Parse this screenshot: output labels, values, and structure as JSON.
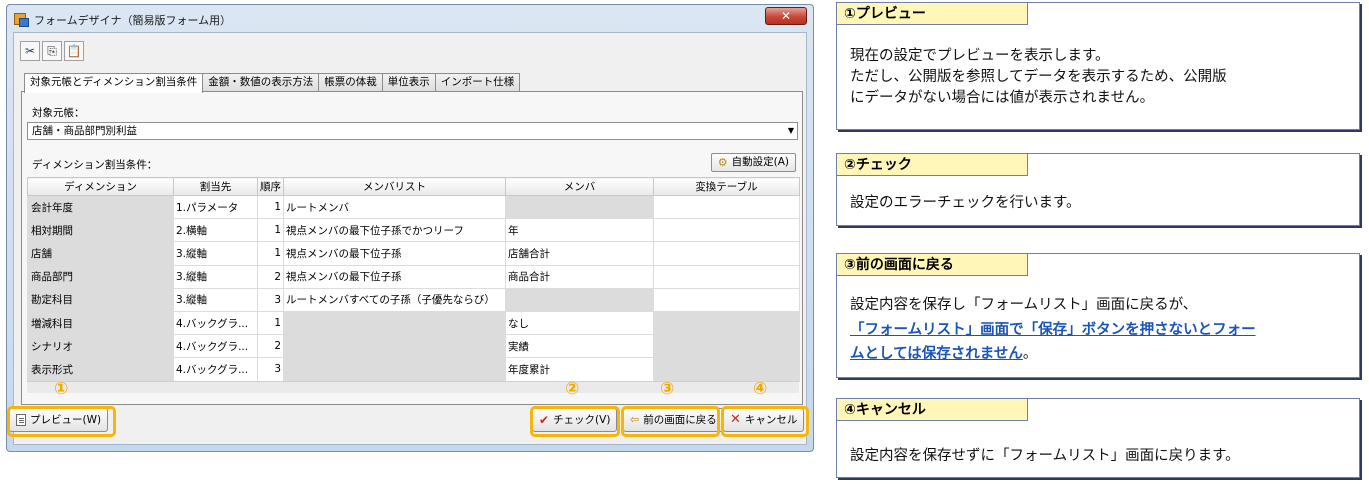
{
  "window": {
    "title": "フォームデザイナ（簡易版フォーム用）",
    "close_glyph": "✕"
  },
  "toolbar": {
    "icons": [
      "scissors-icon",
      "copy-icon",
      "paste-icon"
    ],
    "glyphs": [
      "✂",
      "⎘",
      "📋"
    ]
  },
  "tabs": [
    {
      "label": "対象元帳とディメンション割当条件",
      "active": true
    },
    {
      "label": "金額・数値の表示方法",
      "active": false
    },
    {
      "label": "帳票の体裁",
      "active": false
    },
    {
      "label": "単位表示",
      "active": false
    },
    {
      "label": "インポート仕様",
      "active": false
    }
  ],
  "target_ledger": {
    "label": "対象元帳：",
    "value": "店舗・商品部門別利益"
  },
  "dimension_section": {
    "label": "ディメンション割当条件：",
    "auto_button": "自動設定(A)"
  },
  "grid": {
    "columns": [
      "ディメンション",
      "割当先",
      "順序",
      "メンバリスト",
      "メンバ",
      "変換テーブル"
    ],
    "rows": [
      {
        "dimension": "会計年度",
        "assign": "1.パラメータ",
        "order": "1",
        "member_list": "ルートメンバ",
        "member": "",
        "conv": ""
      },
      {
        "dimension": "相対期間",
        "assign": "2.横軸",
        "order": "1",
        "member_list": "視点メンバの最下位子孫でかつリーフ",
        "member": "年",
        "conv": ""
      },
      {
        "dimension": "店舗",
        "assign": "3.縦軸",
        "order": "1",
        "member_list": "視点メンバの最下位子孫",
        "member": "店舗合計",
        "conv": ""
      },
      {
        "dimension": "商品部門",
        "assign": "3.縦軸",
        "order": "2",
        "member_list": "視点メンバの最下位子孫",
        "member": "商品合計",
        "conv": ""
      },
      {
        "dimension": "勘定科目",
        "assign": "3.縦軸",
        "order": "3",
        "member_list": "ルートメンバすべての子孫（子優先ならび）",
        "member": "",
        "conv": ""
      },
      {
        "dimension": "増減科目",
        "assign": "4.バックグラ...",
        "order": "1",
        "member_list": "",
        "member": "なし",
        "conv": ""
      },
      {
        "dimension": "シナリオ",
        "assign": "4.バックグラ...",
        "order": "2",
        "member_list": "",
        "member": "実績",
        "conv": ""
      },
      {
        "dimension": "表示形式",
        "assign": "4.バックグラ...",
        "order": "3",
        "member_list": "",
        "member": "年度累計",
        "conv": ""
      }
    ]
  },
  "buttons": {
    "preview": "プレビュー(W)",
    "check": "チェック(V)",
    "back": "前の画面に戻る",
    "cancel": "キャンセル"
  },
  "markers": [
    "①",
    "②",
    "③",
    "④"
  ],
  "callouts": {
    "preview": {
      "title": "①プレビュー",
      "lines": [
        "現在の設定でプレビューを表示します。",
        "ただし、公開版を参照してデータを表示するため、公開版",
        "にデータがない場合には値が表示されません。"
      ]
    },
    "check": {
      "title": "②チェック",
      "lines": [
        "設定のエラーチェックを行います。"
      ]
    },
    "back": {
      "title": "③前の画面に戻る",
      "line1": "設定内容を保存し「フォームリスト」画面に戻るが、",
      "link_line1": "「フォームリスト」画面で「保存」ボタンを押さないとフォー",
      "link_line2": "ムとしては保存されません",
      "line_end": "。"
    },
    "cancel": {
      "title": "④キャンセル",
      "lines": [
        "設定内容を保存せずに「フォームリスト」画面に戻ります。"
      ]
    }
  },
  "colors": {
    "highlight": "#f5b50a",
    "callout_header": "#fff6b7",
    "link": "#1a55b7"
  }
}
